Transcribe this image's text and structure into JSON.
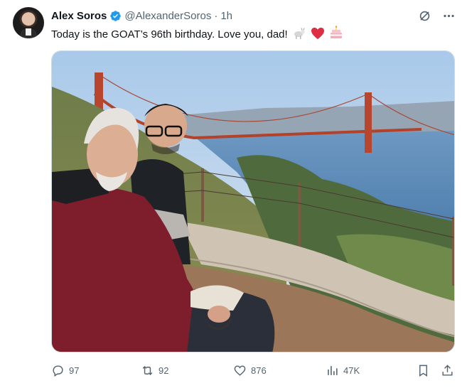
{
  "author": {
    "display_name": "Alex Soros",
    "handle": "@AlexanderSoros",
    "separator": "·",
    "time": "1h",
    "verified": true,
    "verified_color": "#1d9bf0"
  },
  "tweet": {
    "text": "Today is the GOAT’s 96th birthday. Love you, dad!",
    "emojis": [
      "goat",
      "red-heart",
      "birthday-cake"
    ]
  },
  "actions": {
    "replies": "97",
    "reposts": "92",
    "likes": "876",
    "views": "47K"
  },
  "top_icons": [
    "grok-icon",
    "more-icon"
  ],
  "colors": {
    "text": "#0f1419",
    "secondary": "#536471",
    "accent": "#1d9bf0"
  }
}
